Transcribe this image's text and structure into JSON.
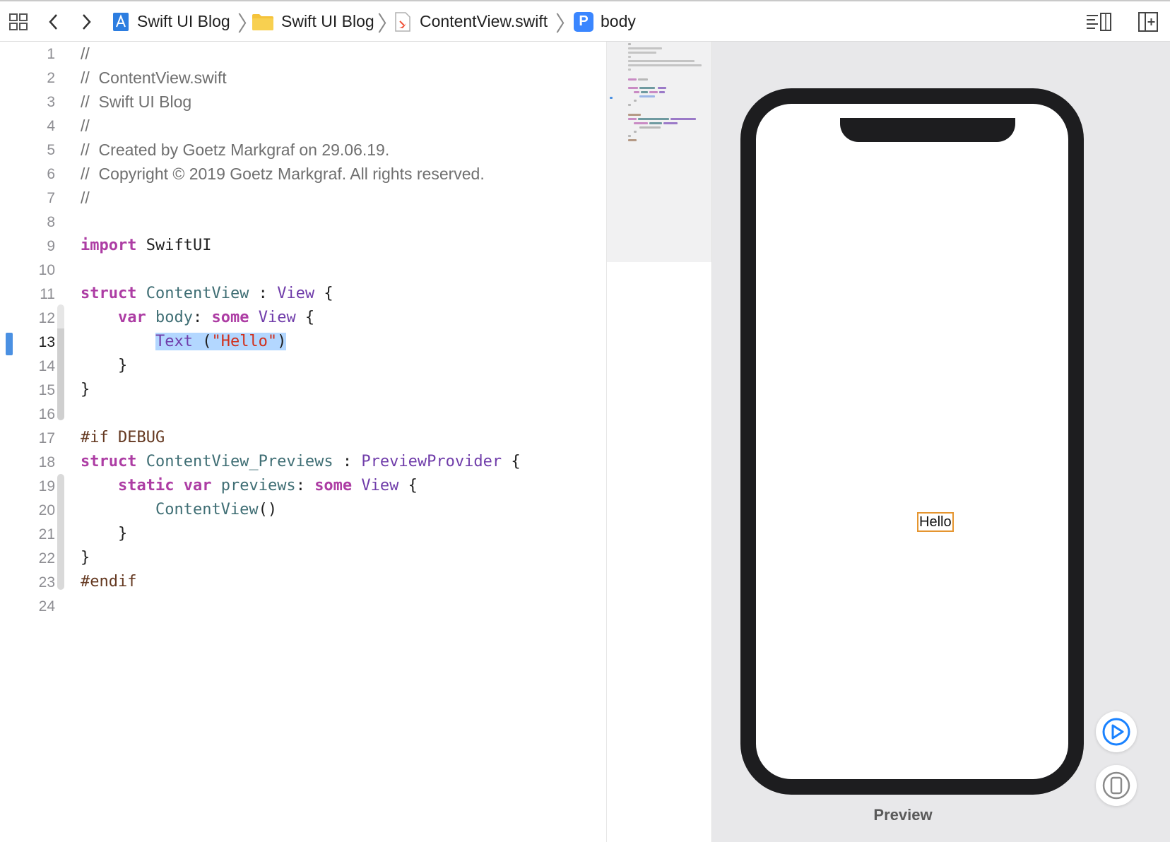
{
  "breadcrumb": {
    "project": "Swift UI Blog",
    "group": "Swift UI Blog",
    "file": "ContentView.swift",
    "symbol_badge": "P",
    "symbol": "body"
  },
  "editor": {
    "current_line": 13,
    "selected_text": "Text (\"Hello\")",
    "line_numbers": [
      "1",
      "2",
      "3",
      "4",
      "5",
      "6",
      "7",
      "8",
      "9",
      "10",
      "11",
      "12",
      "13",
      "14",
      "15",
      "16",
      "17",
      "18",
      "19",
      "20",
      "21",
      "22",
      "23",
      "24"
    ],
    "lines": [
      "//",
      "//  ContentView.swift",
      "//  Swift UI Blog",
      "//",
      "//  Created by Goetz Markgraf on 29.06.19.",
      "//  Copyright © 2019 Goetz Markgraf. All rights reserved.",
      "//",
      "",
      "import SwiftUI",
      "",
      "struct ContentView : View {",
      "    var body: some View {",
      "        Text (\"Hello\")",
      "    }",
      "}",
      "",
      "#if DEBUG",
      "struct ContentView_Previews : PreviewProvider {",
      "    static var previews: some View {",
      "        ContentView()",
      "    }",
      "}",
      "#endif",
      ""
    ]
  },
  "preview": {
    "hello_text": "Hello",
    "label": "Preview"
  },
  "colors": {
    "keyword": "#ad3da4",
    "type": "#3f6e74",
    "system_type": "#703daa",
    "string": "#d12f1b",
    "preprocessor": "#643820",
    "comment": "#6f6f6f",
    "selection": "#b3d7ff",
    "accent": "#1a82ff"
  },
  "icons": {
    "related_items": "grid-icon",
    "back": "chevron-left-icon",
    "forward": "chevron-right-icon",
    "project": "xcode-project-icon",
    "folder": "folder-icon",
    "swift_file": "swift-file-icon",
    "editor_options": "editor-lines-icon",
    "add_editor": "add-editor-icon",
    "live_preview": "play-circle-icon",
    "device": "device-icon"
  }
}
